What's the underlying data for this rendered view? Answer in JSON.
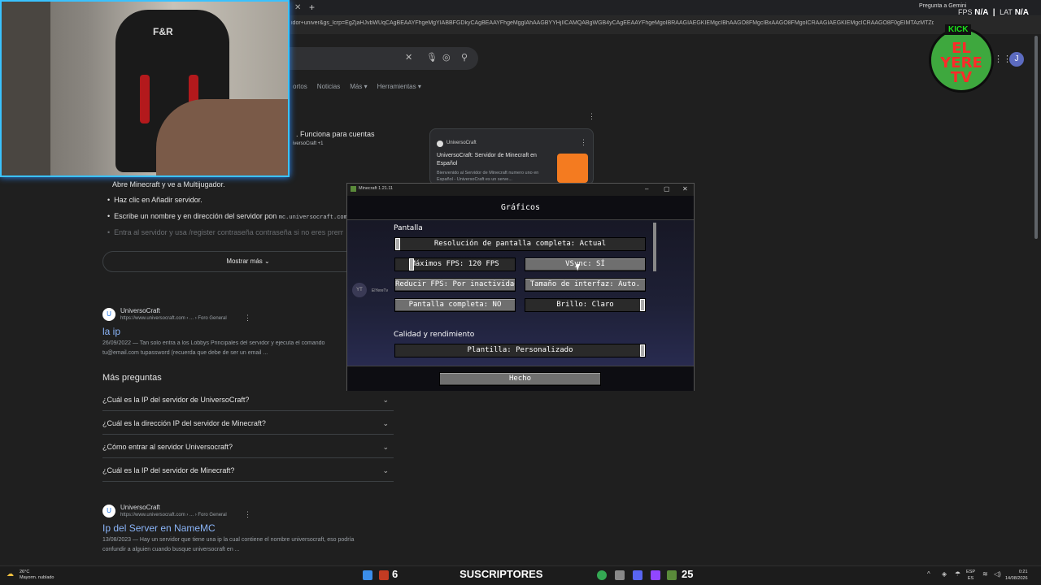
{
  "browser": {
    "url": "idor+univer&gs_lcrp=EgZjaHJvbWUqCAgBEAAYFhgeMgYIABBFGDkyCAgBEAAYFhgeMggIAhAAGBYYHjIICAMQABgWGB4yCAgEEAAYFhgeMgoIBRAAGIAEGKIEMgcIBhAAGO8FMgcIBxAAGO8FMgoICRAAGIAEGKIEMgcICRAAGO8F0gEIMTAzMTZqMGo0qAIAs...",
    "gemini_label": "Pregunta a Gemini",
    "search_tabs": [
      "ortos",
      "Noticias",
      "Más ▾",
      "Herramientas ▾"
    ]
  },
  "overlay": {
    "fps_label": "FPS",
    "fps_value": "N/A",
    "lat_label": "LAT",
    "lat_value": "N/A",
    "logo_kick": "KICK",
    "logo_text": "EL YERE TV",
    "avatar_letter": "J"
  },
  "results": {
    "funciona": ". Funciona para cuentas",
    "funciona_sub": "iversoCraft +1",
    "steps_partial": "Abre Minecraft y ve a Multijugador.",
    "step_add": "Haz clic en Añadir servidor.",
    "step_name": "Escribe un nombre y en dirección del servidor pon",
    "step_name_code": "mc.universocraft.com",
    "step_register": "Entra al servidor y usa /register contraseña contraseña si no eres premium",
    "mostrar_mas": "Mostrar más ⌄",
    "r1": {
      "site": "UniversoCraft",
      "url": "https://www.universocraft.com › ... › Foro General",
      "title": "la ip",
      "snippet1": "26/09/2022 — Tan solo entra a los Lobbys Principales del servidor y ejecuta el comando",
      "snippet2": "tu@email.com tupassword (recuerda que debe de ser un email ..."
    },
    "paa_title": "Más preguntas",
    "paa": [
      "¿Cuál es la IP del servidor de UniversoCraft?",
      "¿Cuál es la dirección IP del servidor de Minecraft?",
      "¿Cómo entrar al servidor Universocraft?",
      "¿Cuál es la IP del servidor de Minecraft?"
    ],
    "r2": {
      "site": "UniversoCraft",
      "url": "https://www.universocraft.com › ... › Foro General",
      "title": "Ip del Server en NameMC",
      "snippet1": "13/08/2023 — Hay un servidor que tiene una ip la cual contiene el nombre universocraft, eso podría",
      "snippet2": "confundir a alguien cuando busque universocraft en ..."
    },
    "card": {
      "site": "UniversoCraft",
      "title": "UniversoCraft: Servidor de Minecraft en Español",
      "desc": "Bienvenido al Servidor de Minecraft numero uno en Español - UniversoCraft es un serve..."
    }
  },
  "minecraft": {
    "window_title": "Minecraft 1.21.11",
    "heading": "Gráficos",
    "section_pantalla": "Pantalla",
    "resolucion": "Resolución de pantalla completa: Actual",
    "max_fps": "Máximos FPS: 120 FPS",
    "max_fps_level": 0.12,
    "vsync": "VSync: SÍ",
    "reducir_fps": "Reducir FPS: Por inactividad",
    "tamano_interfaz": "Tamaño de interfaz: Auto.",
    "pantalla_completa": "Pantalla completa: NO",
    "brillo": "Brillo: Claro",
    "section_calidad": "Calidad y rendimiento",
    "plantilla": "Plantilla: Personalizado",
    "hecho": "Hecho",
    "ghost_label": "ElYereTv"
  },
  "taskbar": {
    "temp": "26°C",
    "weather": "Mayorm. nublado",
    "count_left": "6",
    "subs_label": "SUSCRIPTORES",
    "subs_count": "25",
    "lang1": "ESP",
    "lang2": "ES",
    "time": "0:21",
    "date": "14/08/2026"
  }
}
